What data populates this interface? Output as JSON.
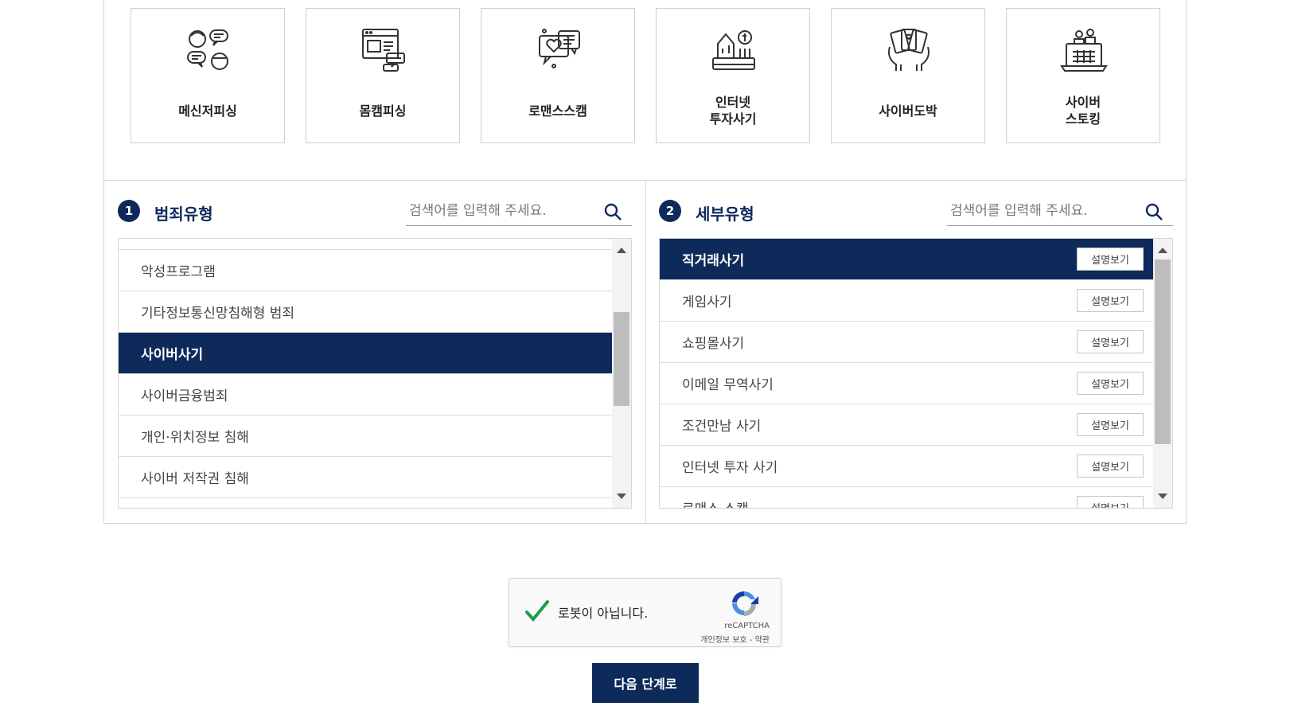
{
  "categories": [
    {
      "label": "메신저피싱",
      "icon": "messenger-chat-icon"
    },
    {
      "label": "몸캠피싱",
      "icon": "webcam-screen-icon"
    },
    {
      "label": "로맨스스캠",
      "icon": "heart-message-icon"
    },
    {
      "label": "인터넷\n투자사기",
      "icon": "investment-growth-icon"
    },
    {
      "label": "사이버도박",
      "icon": "gambling-cards-icon"
    },
    {
      "label": "사이버\n스토킹",
      "icon": "laptop-stalking-icon"
    }
  ],
  "panel1": {
    "number": "1",
    "title": "범죄유형",
    "search_placeholder": "검색어를 입력해 주세요.",
    "items": [
      {
        "label": "악성프로그램",
        "selected": false
      },
      {
        "label": "기타정보통신망침해형 범죄",
        "selected": false
      },
      {
        "label": "사이버사기",
        "selected": true
      },
      {
        "label": "사이버금융범죄",
        "selected": false
      },
      {
        "label": "개인·위치정보 침해",
        "selected": false
      },
      {
        "label": "사이버 저작권 침해",
        "selected": false
      }
    ]
  },
  "panel2": {
    "number": "2",
    "title": "세부유형",
    "search_placeholder": "검색어를 입력해 주세요.",
    "detail_button_label": "설명보기",
    "items": [
      {
        "label": "직거래사기",
        "selected": true
      },
      {
        "label": "게임사기",
        "selected": false
      },
      {
        "label": "쇼핑몰사기",
        "selected": false
      },
      {
        "label": "이메일 무역사기",
        "selected": false
      },
      {
        "label": "조건만남 사기",
        "selected": false
      },
      {
        "label": "인터넷 투자 사기",
        "selected": false
      },
      {
        "label": "로맨스 스캠",
        "selected": false
      }
    ]
  },
  "captcha": {
    "text": "로봇이 아닙니다.",
    "brand": "reCAPTCHA",
    "terms": "개인정보 보호 - 약관",
    "checked": true
  },
  "next_button_label": "다음 단계로",
  "colors": {
    "primary": "#0e2a5a",
    "check": "#1e9e4a"
  }
}
